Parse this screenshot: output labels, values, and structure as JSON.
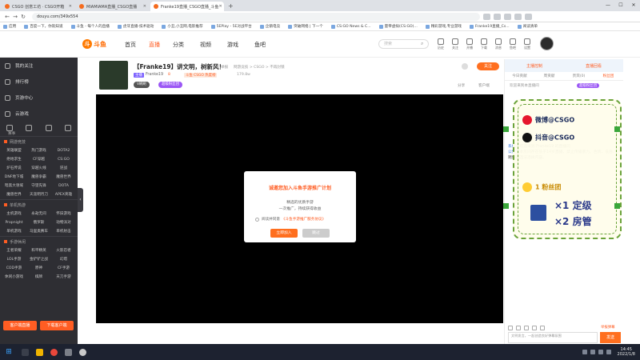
{
  "browser": {
    "tabs": [
      {
        "title": "CSGO 创意工坊 · CSGO开箱"
      },
      {
        "title": "MIAMIAMA直播_CSGO直播"
      },
      {
        "title": "Franke19直播_CSGO直播_斗鱼",
        "active": true
      }
    ],
    "new_tab": "+",
    "url": "douyu.com/349x554",
    "bookmarks": [
      "应用",
      "百度一下，你就知道",
      "斗鱼 - 每个人的直播",
      "虎牙直播-技术驱动",
      "小丑,小丑网,电影推荐",
      "5EPlay - 5E对战平台",
      "企鹅电竞",
      "突破网络 | 下一个",
      "CS:GO News & C...",
      "量帝虚拟(CS:GO)...",
      "精彩游戏,专业游戏",
      "Franke19直播_Cs...",
      "阅读清单"
    ]
  },
  "site": {
    "logo_text": "斗鱼",
    "nav": [
      "首页",
      "直播",
      "分类",
      "视频",
      "游戏",
      "鱼吧"
    ],
    "search_placeholder": "搜索",
    "header_icons": [
      "历史",
      "关注",
      "开播",
      "下载",
      "消息",
      "鱼吧",
      "设置"
    ]
  },
  "sidebar": {
    "items": [
      "我的关注",
      "排行榜",
      "页游中心",
      "云游戏"
    ],
    "small_label": "赛事",
    "sections": [
      {
        "title": "网游竞技",
        "games": [
          "英雄联盟",
          "热门游戏",
          "DOTA2",
          "绝地求生",
          "CF穿越",
          "CS:GO",
          "炉石传说",
          "穿越火线",
          "逆战",
          "DNF地下城",
          "魔兽争霸",
          "魔兽世界",
          "暗黑大领域",
          "守望先锋",
          "DOTA",
          "魔兽世界",
          "天涯明月刀",
          "APEX英雄"
        ]
      },
      {
        "title": "单机热游",
        "games": [
          "主机游戏",
          "永劫无间",
          "怀旧游戏",
          "Propnight",
          "俄罗斯",
          "动物派对",
          "单机游戏",
          "马里奥赛车",
          "单机射击"
        ]
      },
      {
        "title": "手游休闲",
        "games": [
          "王者荣耀",
          "和平精英",
          "火影忍者",
          "LOL手游",
          "金铲铲之战",
          "幻塔",
          "COD手游",
          "原神",
          "CF手游",
          "休闲小游戏",
          "棋牌",
          "天刀手游"
        ]
      }
    ],
    "btn_live": "客户端直播",
    "btn_download": "下载客户端"
  },
  "room": {
    "title": "【Franke19】讲文明，树新风！",
    "tag_report": "举报",
    "tag_category": "网游竞技 > CSGO > 不再封锁",
    "live_tag": "主播",
    "anchor_name": "Franke19",
    "anchor_level": "8",
    "rank_tag": "斗鱼 CSGO 热度榜",
    "hot_count": "179.8w",
    "badge_1": "V刷刷",
    "badge_2": "超级粉丝团",
    "follow": "关注",
    "share": "分享",
    "report": "客户端"
  },
  "modal": {
    "title": "诚邀您加入斗鱼手游推广计划",
    "line_1": "精选的优质手游",
    "line_2": "一次推广，持续获得收益",
    "agree_text": "阅读并同意",
    "agree_link": "《斗鱼手游推广服务协议》",
    "join": "立即加入",
    "skip": "跳过"
  },
  "right_panel": {
    "top": [
      "主播控制",
      "直播回看"
    ],
    "tabs": [
      "今日贡献",
      "周贡献",
      "贵宾(0)",
      "粉丝团"
    ],
    "notice": "欢迎来到本直播间",
    "notice_badge": "超级粉丝团",
    "chat": [
      {
        "user": "系统：",
        "text": "欢迎来到 Franke19 的直播间"
      },
      {
        "user": "公告：",
        "text": "本房间存在低于14岁直播，禁止传播暴力、色情、低俗、赌博等违法违规内容。"
      }
    ],
    "overlay": {
      "weibo": "微博@CSGO",
      "douyin": "抖音@CSGO",
      "line_rank": "1 粉丝团",
      "rule_1": "×1 定级",
      "rule_2": "×2 房管"
    },
    "report": "举报弹幕",
    "send": "发送",
    "input_placeholder": "文明发言，一起创造良好弹幕氛围"
  },
  "taskbar": {
    "time": "14:45",
    "date": "2022/1/8"
  }
}
